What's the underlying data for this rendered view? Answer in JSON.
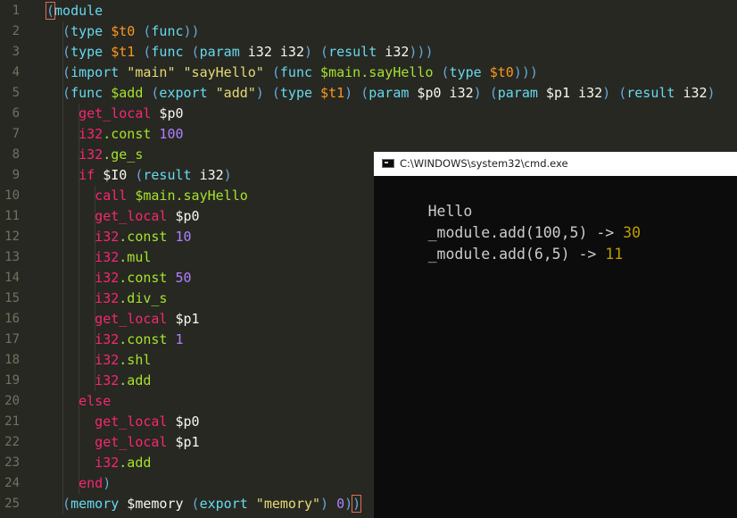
{
  "colors": {
    "editor_bg": "#272822",
    "plain": "#f8f8f2",
    "paren": "#66a8d9",
    "keyword": "#66d9ef",
    "variable": "#fd971f",
    "string": "#e6db74",
    "instruction": "#f92672",
    "number": "#ae81ff",
    "symbol": "#a6e22e",
    "line_number": "#75715e",
    "console_text": "#cccccc",
    "console_number": "#c19c00"
  },
  "editor": {
    "lines": [
      {
        "num": "1",
        "indent": 0,
        "tokens": [
          {
            "t": "(",
            "c": "paren",
            "hl": true
          },
          {
            "t": "module",
            "c": "keyword"
          }
        ]
      },
      {
        "num": "2",
        "indent": 1,
        "tokens": [
          {
            "t": "(",
            "c": "paren"
          },
          {
            "t": "type ",
            "c": "keyword"
          },
          {
            "t": "$t0",
            "c": "variable"
          },
          {
            "t": " ",
            "c": "plain"
          },
          {
            "t": "(",
            "c": "paren"
          },
          {
            "t": "func",
            "c": "keyword"
          },
          {
            "t": "))",
            "c": "paren"
          }
        ]
      },
      {
        "num": "3",
        "indent": 1,
        "tokens": [
          {
            "t": "(",
            "c": "paren"
          },
          {
            "t": "type ",
            "c": "keyword"
          },
          {
            "t": "$t1",
            "c": "variable"
          },
          {
            "t": " ",
            "c": "plain"
          },
          {
            "t": "(",
            "c": "paren"
          },
          {
            "t": "func ",
            "c": "keyword"
          },
          {
            "t": "(",
            "c": "paren"
          },
          {
            "t": "param ",
            "c": "keyword"
          },
          {
            "t": "i32 i32",
            "c": "plain"
          },
          {
            "t": ") (",
            "c": "paren"
          },
          {
            "t": "result ",
            "c": "keyword"
          },
          {
            "t": "i32",
            "c": "plain"
          },
          {
            "t": ")))",
            "c": "paren"
          }
        ]
      },
      {
        "num": "4",
        "indent": 1,
        "tokens": [
          {
            "t": "(",
            "c": "paren"
          },
          {
            "t": "import ",
            "c": "keyword"
          },
          {
            "t": "\"main\" \"sayHello\"",
            "c": "string"
          },
          {
            "t": " ",
            "c": "plain"
          },
          {
            "t": "(",
            "c": "paren"
          },
          {
            "t": "func ",
            "c": "keyword"
          },
          {
            "t": "$main.sayHello",
            "c": "symbol"
          },
          {
            "t": " ",
            "c": "plain"
          },
          {
            "t": "(",
            "c": "paren"
          },
          {
            "t": "type ",
            "c": "keyword"
          },
          {
            "t": "$t0",
            "c": "variable"
          },
          {
            "t": ")))",
            "c": "paren"
          }
        ]
      },
      {
        "num": "5",
        "indent": 1,
        "tokens": [
          {
            "t": "(",
            "c": "paren"
          },
          {
            "t": "func ",
            "c": "keyword"
          },
          {
            "t": "$add",
            "c": "symbol"
          },
          {
            "t": " ",
            "c": "plain"
          },
          {
            "t": "(",
            "c": "paren"
          },
          {
            "t": "export ",
            "c": "keyword"
          },
          {
            "t": "\"add\"",
            "c": "string"
          },
          {
            "t": ") (",
            "c": "paren"
          },
          {
            "t": "type ",
            "c": "keyword"
          },
          {
            "t": "$t1",
            "c": "variable"
          },
          {
            "t": ") (",
            "c": "paren"
          },
          {
            "t": "param ",
            "c": "keyword"
          },
          {
            "t": "$p0 i32",
            "c": "plain"
          },
          {
            "t": ") (",
            "c": "paren"
          },
          {
            "t": "param ",
            "c": "keyword"
          },
          {
            "t": "$p1 i32",
            "c": "plain"
          },
          {
            "t": ") (",
            "c": "paren"
          },
          {
            "t": "result ",
            "c": "keyword"
          },
          {
            "t": "i32",
            "c": "plain"
          },
          {
            "t": ")",
            "c": "paren"
          }
        ]
      },
      {
        "num": "6",
        "indent": 2,
        "tokens": [
          {
            "t": "get_local",
            "c": "instruction"
          },
          {
            "t": " $p0",
            "c": "plain"
          }
        ]
      },
      {
        "num": "7",
        "indent": 2,
        "tokens": [
          {
            "t": "i32",
            "c": "instruction"
          },
          {
            "t": ".const ",
            "c": "symbol"
          },
          {
            "t": "100",
            "c": "number"
          }
        ]
      },
      {
        "num": "8",
        "indent": 2,
        "tokens": [
          {
            "t": "i32",
            "c": "instruction"
          },
          {
            "t": ".ge_s",
            "c": "symbol"
          }
        ]
      },
      {
        "num": "9",
        "indent": 2,
        "tokens": [
          {
            "t": "if ",
            "c": "instruction"
          },
          {
            "t": "$I0 ",
            "c": "plain"
          },
          {
            "t": "(",
            "c": "paren"
          },
          {
            "t": "result ",
            "c": "keyword"
          },
          {
            "t": "i32",
            "c": "plain"
          },
          {
            "t": ")",
            "c": "paren"
          }
        ]
      },
      {
        "num": "10",
        "indent": 3,
        "tokens": [
          {
            "t": "call ",
            "c": "instruction"
          },
          {
            "t": "$main.sayHello",
            "c": "symbol"
          }
        ]
      },
      {
        "num": "11",
        "indent": 3,
        "tokens": [
          {
            "t": "get_local",
            "c": "instruction"
          },
          {
            "t": " $p0",
            "c": "plain"
          }
        ]
      },
      {
        "num": "12",
        "indent": 3,
        "tokens": [
          {
            "t": "i32",
            "c": "instruction"
          },
          {
            "t": ".const ",
            "c": "symbol"
          },
          {
            "t": "10",
            "c": "number"
          }
        ]
      },
      {
        "num": "13",
        "indent": 3,
        "tokens": [
          {
            "t": "i32",
            "c": "instruction"
          },
          {
            "t": ".mul",
            "c": "symbol"
          }
        ]
      },
      {
        "num": "14",
        "indent": 3,
        "tokens": [
          {
            "t": "i32",
            "c": "instruction"
          },
          {
            "t": ".const ",
            "c": "symbol"
          },
          {
            "t": "50",
            "c": "number"
          }
        ]
      },
      {
        "num": "15",
        "indent": 3,
        "tokens": [
          {
            "t": "i32",
            "c": "instruction"
          },
          {
            "t": ".div_s",
            "c": "symbol"
          }
        ]
      },
      {
        "num": "16",
        "indent": 3,
        "tokens": [
          {
            "t": "get_local",
            "c": "instruction"
          },
          {
            "t": " $p1",
            "c": "plain"
          }
        ]
      },
      {
        "num": "17",
        "indent": 3,
        "tokens": [
          {
            "t": "i32",
            "c": "instruction"
          },
          {
            "t": ".const ",
            "c": "symbol"
          },
          {
            "t": "1",
            "c": "number"
          }
        ]
      },
      {
        "num": "18",
        "indent": 3,
        "tokens": [
          {
            "t": "i32",
            "c": "instruction"
          },
          {
            "t": ".shl",
            "c": "symbol"
          }
        ]
      },
      {
        "num": "19",
        "indent": 3,
        "tokens": [
          {
            "t": "i32",
            "c": "instruction"
          },
          {
            "t": ".add",
            "c": "symbol"
          }
        ]
      },
      {
        "num": "20",
        "indent": 2,
        "tokens": [
          {
            "t": "else",
            "c": "instruction"
          }
        ]
      },
      {
        "num": "21",
        "indent": 3,
        "tokens": [
          {
            "t": "get_local",
            "c": "instruction"
          },
          {
            "t": " $p0",
            "c": "plain"
          }
        ]
      },
      {
        "num": "22",
        "indent": 3,
        "tokens": [
          {
            "t": "get_local",
            "c": "instruction"
          },
          {
            "t": " $p1",
            "c": "plain"
          }
        ]
      },
      {
        "num": "23",
        "indent": 3,
        "tokens": [
          {
            "t": "i32",
            "c": "instruction"
          },
          {
            "t": ".add",
            "c": "symbol"
          }
        ]
      },
      {
        "num": "24",
        "indent": 2,
        "tokens": [
          {
            "t": "end",
            "c": "instruction"
          },
          {
            "t": ")",
            "c": "paren"
          }
        ]
      },
      {
        "num": "25",
        "indent": 1,
        "tokens": [
          {
            "t": "(",
            "c": "paren"
          },
          {
            "t": "memory ",
            "c": "keyword"
          },
          {
            "t": "$memory ",
            "c": "plain"
          },
          {
            "t": "(",
            "c": "paren"
          },
          {
            "t": "export ",
            "c": "keyword"
          },
          {
            "t": "\"memory\"",
            "c": "string"
          },
          {
            "t": ") ",
            "c": "paren"
          },
          {
            "t": "0",
            "c": "number"
          },
          {
            "t": ")",
            "c": "paren"
          },
          {
            "t": ")",
            "c": "paren",
            "hl": true
          }
        ]
      }
    ]
  },
  "console": {
    "title": "C:\\WINDOWS\\system32\\cmd.exe",
    "icon": "console-app-icon",
    "lines": [
      {
        "text": "Hello",
        "result": ""
      },
      {
        "text": "_module.add(100,5) -> ",
        "result": "30"
      },
      {
        "text": "_module.add(6,5) -> ",
        "result": "11"
      }
    ]
  }
}
